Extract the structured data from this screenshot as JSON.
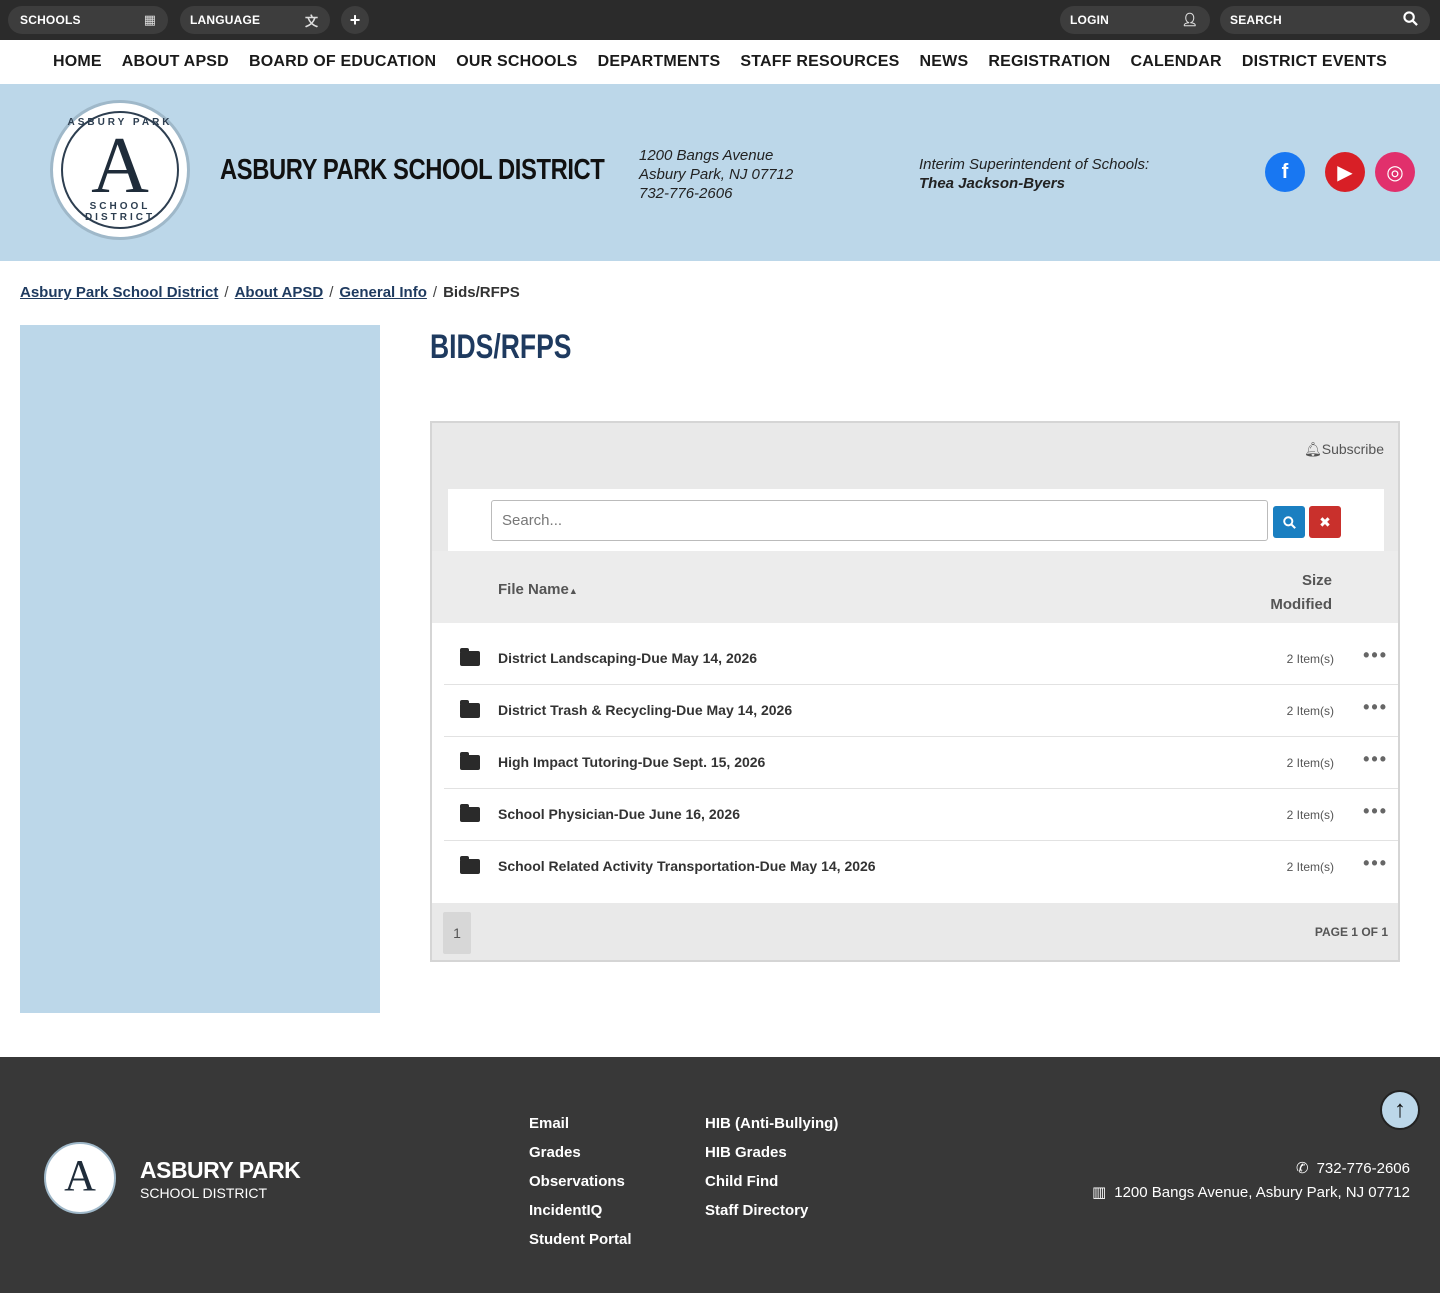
{
  "utility": {
    "schools_label": "SCHOOLS",
    "language_label": "LANGUAGE",
    "plus_label": "+",
    "login_label": "LOGIN",
    "search_label": "SEARCH"
  },
  "nav": {
    "items": [
      "HOME",
      "ABOUT APSD",
      "BOARD OF EDUCATION",
      "OUR SCHOOLS",
      "DEPARTMENTS",
      "STAFF RESOURCES",
      "NEWS",
      "REGISTRATION",
      "CALENDAR",
      "DISTRICT EVENTS"
    ]
  },
  "header": {
    "logo_top": "ASBURY PARK",
    "logo_mono": "A",
    "logo_bottom": "SCHOOL DISTRICT",
    "title": "ASBURY PARK SCHOOL DISTRICT",
    "address_line1": "1200 Bangs Avenue",
    "address_line2": "Asbury Park, NJ 07712",
    "phone": "732-776-2606",
    "supt_label": "Interim Superintendent of Schools:",
    "supt_name": "Thea Jackson-Byers",
    "social": {
      "facebook": "f",
      "youtube": "▶",
      "instagram": "◎"
    }
  },
  "breadcrumb": {
    "items": [
      "Asbury Park School District",
      "About APSD",
      "General Info"
    ],
    "separator": "/",
    "current": "Bids/RFPS"
  },
  "page": {
    "title": "BIDS/RFPS"
  },
  "files": {
    "subscribe_label": "Subscribe",
    "search_placeholder": "Search...",
    "col_file": "File Name",
    "col_size": "Size",
    "col_modified": "Modified",
    "rows": [
      {
        "name": "District Landscaping-Due May 14, 2026",
        "size": "2 Item(s)"
      },
      {
        "name": "District Trash & Recycling-Due May 14, 2026",
        "size": "2 Item(s)"
      },
      {
        "name": "High Impact Tutoring-Due Sept. 15, 2026",
        "size": "2 Item(s)"
      },
      {
        "name": "School Physician-Due June 16, 2026",
        "size": "2 Item(s)"
      },
      {
        "name": "School Related Activity Transportation-Due May 14, 2026",
        "size": "2 Item(s)"
      }
    ],
    "more_label": "•••",
    "page_number": "1",
    "page_of": "PAGE 1 OF 1"
  },
  "footer": {
    "title": "ASBURY PARK",
    "subtitle": "SCHOOL DISTRICT",
    "col1": [
      "Email",
      "Grades",
      "Observations",
      "IncidentIQ",
      "Student Portal"
    ],
    "col2": [
      "HIB (Anti-Bullying)",
      "HIB Grades",
      "Child Find",
      "Staff Directory"
    ],
    "phone": "732-776-2606",
    "address": "1200 Bangs Avenue, Asbury Park, NJ 07712"
  },
  "colors": {
    "light_blue": "#bcd7e9",
    "navy": "#1e3a5f",
    "dark_bar": "#2b2b2b",
    "footer": "#383838",
    "search_button": "#1a7fc1",
    "clear_button": "#c9302c"
  }
}
